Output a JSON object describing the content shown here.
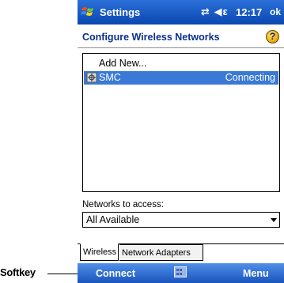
{
  "annotation": {
    "label": "Softkey"
  },
  "titlebar": {
    "app_title": "Settings",
    "status_icons": "⇄ ◀ε",
    "time": "12:17",
    "ok_label": "ok"
  },
  "header": {
    "title": "Configure Wireless Networks",
    "help_glyph": "?"
  },
  "network_list": {
    "add_new": "Add New...",
    "items": [
      {
        "name": "SMC",
        "status": "Connecting",
        "selected": true
      }
    ]
  },
  "access": {
    "label": "Networks to access:",
    "selected": "All Available"
  },
  "tabs": [
    {
      "label": "Wireless",
      "active": true
    },
    {
      "label": "Network Adapters",
      "active": false
    }
  ],
  "softkeys": {
    "left": "Connect",
    "right": "Menu"
  },
  "colors": {
    "titlebar": "#0b47b0",
    "selection": "#3a7ad6",
    "header_text": "#0a2f8a"
  }
}
